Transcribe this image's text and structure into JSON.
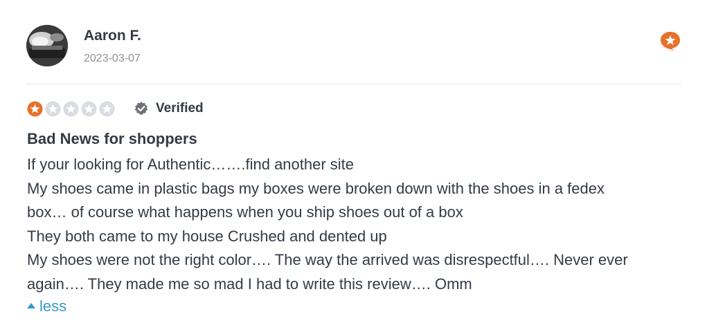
{
  "reviewer": {
    "name": "Aaron F.",
    "date": "2023-03-07",
    "avatar_icon": "user-photo"
  },
  "rating": {
    "value": 1,
    "max": 5,
    "filled_color": "#e8712a",
    "empty_color": "#d9dce0"
  },
  "verified": {
    "label": "Verified",
    "icon": "verified-badge-icon"
  },
  "review": {
    "title": "Bad News for shoppers",
    "lines": [
      "If your looking for Authentic…….find another site",
      "My shoes came in plastic bags my boxes were broken down with the shoes in a fedex",
      "box… of course what happens when you ship shoes out of a box",
      "They both came to my house Crushed and dented up",
      "My shoes were not the right color…. The way the arrived was disrespectful…. Never ever",
      "again…. They made me so mad I had to write this review…. Omm"
    ]
  },
  "toggle": {
    "label": "less",
    "icon": "caret-up-icon"
  },
  "badge": {
    "icon": "star-speech-bubble-icon",
    "color": "#e8712a"
  }
}
